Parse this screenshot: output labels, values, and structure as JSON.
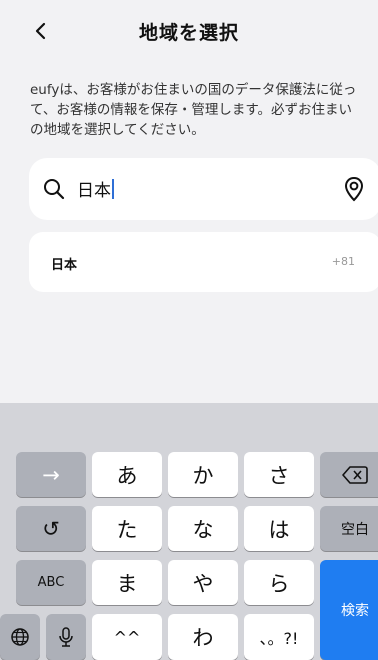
{
  "header": {
    "title": "地域を選択"
  },
  "notice": "eufyは、お客様がお住まいの国のデータ保護法に従って、お客様の情報を保存・管理します。必ずお住まいの地域を選択してください。",
  "search": {
    "value": "日本"
  },
  "results": [
    {
      "name": "日本",
      "code": "+81"
    }
  ],
  "keyboard": {
    "arrow": "→",
    "undo": "↺",
    "kana_row1": [
      "あ",
      "か",
      "さ"
    ],
    "kana_row2": [
      "た",
      "な",
      "は"
    ],
    "kana_row3": [
      "ま",
      "や",
      "ら"
    ],
    "kana_row4": [
      "^^",
      "わ",
      "、。?!"
    ],
    "space_label": "空白",
    "abc_label": "ABC",
    "search_label": "検索"
  },
  "colors": {
    "accent": "#1f7df1",
    "background": "#f2f2f4",
    "keyboard": "#d3d4d9"
  }
}
